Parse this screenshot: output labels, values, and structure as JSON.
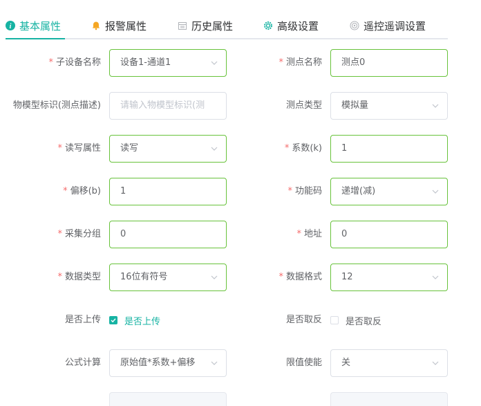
{
  "tabs": [
    {
      "label": "基本属性",
      "icon": "info-circle-icon",
      "active": true
    },
    {
      "label": "报警属性",
      "icon": "bell-icon",
      "active": false
    },
    {
      "label": "历史属性",
      "icon": "calendar-icon",
      "active": false
    },
    {
      "label": "高级设置",
      "icon": "gear-icon",
      "active": false
    },
    {
      "label": "遥控遥调设置",
      "icon": "target-icon",
      "active": false
    }
  ],
  "colors": {
    "accent": "#17b3a3",
    "required": "#f56c6c",
    "valid_border": "#67c23a"
  },
  "form": {
    "sub_device_name": {
      "label": "子设备名称",
      "required": true,
      "value": "设备1-通道1"
    },
    "point_name": {
      "label": "测点名称",
      "required": true,
      "value": "测点0"
    },
    "model_id": {
      "label": "物模型标识(测点描述)",
      "required": false,
      "placeholder": "请输入物模型标识(测"
    },
    "point_type": {
      "label": "测点类型",
      "required": false,
      "value": "模拟量"
    },
    "rw_attr": {
      "label": "读写属性",
      "required": true,
      "value": "读写"
    },
    "coefficient": {
      "label": "系数(k)",
      "required": true,
      "value": "1"
    },
    "offset": {
      "label": "偏移(b)",
      "required": true,
      "value": "1"
    },
    "function_code": {
      "label": "功能码",
      "required": true,
      "value": "递增(减)"
    },
    "collect_group": {
      "label": "采集分组",
      "required": true,
      "value": "0"
    },
    "address": {
      "label": "地址",
      "required": true,
      "value": "0"
    },
    "data_type": {
      "label": "数据类型",
      "required": true,
      "value": "16位有符号"
    },
    "data_format": {
      "label": "数据格式",
      "required": true,
      "value": "12"
    },
    "upload": {
      "label": "是否上传",
      "checkbox_label": "是否上传",
      "checked": true
    },
    "invert": {
      "label": "是否取反",
      "checkbox_label": "是否取反",
      "checked": false
    },
    "formula": {
      "label": "公式计算",
      "value": "原始值*系数+偏移"
    },
    "limit_enable": {
      "label": "限值使能",
      "value": "关"
    }
  }
}
